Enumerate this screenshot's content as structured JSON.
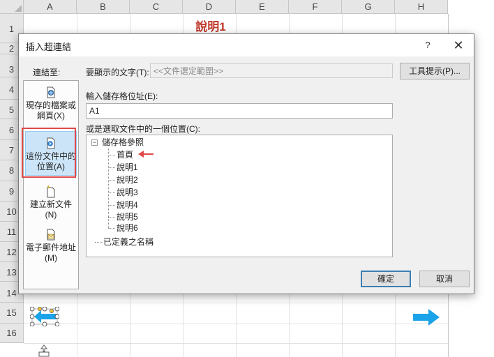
{
  "spreadsheet": {
    "columns": [
      "A",
      "B",
      "C",
      "D",
      "E",
      "F",
      "G",
      "H"
    ],
    "rows": [
      "1",
      "2",
      "3",
      "4",
      "5",
      "6",
      "7",
      "8",
      "9",
      "10",
      "11",
      "12",
      "13",
      "14",
      "15",
      "16"
    ],
    "title_cell": "說明1"
  },
  "dialog": {
    "title": "插入超連結",
    "help_label": "?",
    "close_label": "✕",
    "link_to_label": "連結至:",
    "nav_items": [
      {
        "label": "現存的檔案或網頁(X)",
        "icon": "existing-file-icon",
        "selected": false
      },
      {
        "label": "這份文件中的位置(A)",
        "icon": "place-in-document-icon",
        "selected": true
      },
      {
        "label": "建立新文件(N)",
        "icon": "new-document-icon",
        "selected": false
      },
      {
        "label": "電子郵件地址(M)",
        "icon": "email-address-icon",
        "selected": false
      }
    ],
    "display_text_label": "要顯示的文字(T):",
    "display_text_value": "<<文件選定範圍>>",
    "screentip_button": "工具提示(P)...",
    "cell_ref_label": "輸入儲存格位址(E):",
    "cell_ref_value": "A1",
    "place_label": "或是選取文件中的一個位置(C):",
    "tree": {
      "root_label": "儲存格參照",
      "root_expander": "−",
      "children": [
        "首頁",
        "說明1",
        "說明2",
        "說明3",
        "說明4",
        "說明5",
        "說明6"
      ],
      "defined_names_label": "已定義之名稱"
    },
    "ok_button": "確定",
    "cancel_button": "取消"
  },
  "colors": {
    "title_red": "#c0392b",
    "annotation_red": "#e04848",
    "selection_blue": "#cce4f7",
    "shape_blue": "#1aa3e8"
  }
}
